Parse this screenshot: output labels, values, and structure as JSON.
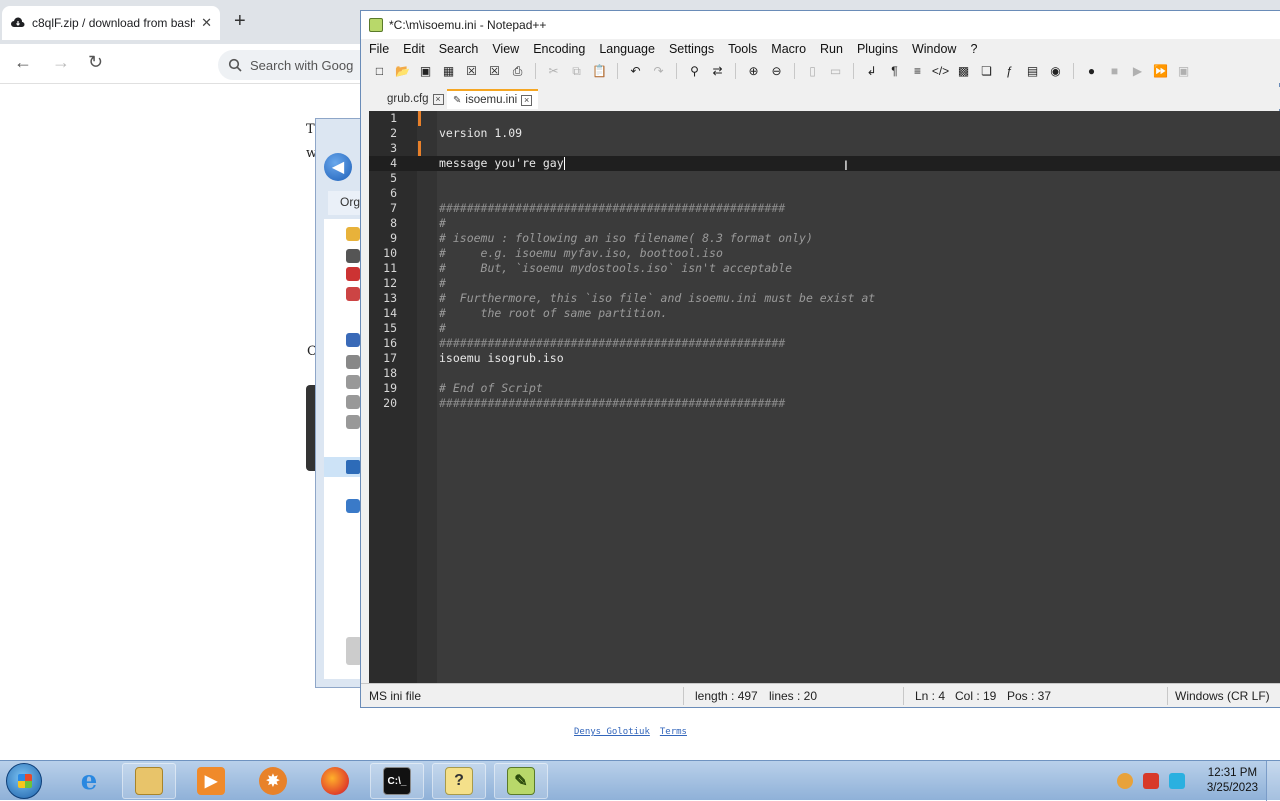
{
  "browser": {
    "tab_title": "c8qlF.zip / download from bash",
    "tab_close": "✕",
    "new_tab": "+",
    "search_placeholder": "Search with Goog",
    "page_fragment_1": "T",
    "page_fragment_2": "w",
    "page_fragment_3": "C",
    "footer_links": [
      "Denys Golotiuk",
      "Terms"
    ]
  },
  "explorer": {
    "organize_label": "Org"
  },
  "npp": {
    "title": "*C:\\m\\isoemu.ini - Notepad++",
    "menu": [
      "File",
      "Edit",
      "Search",
      "View",
      "Encoding",
      "Language",
      "Settings",
      "Tools",
      "Macro",
      "Run",
      "Plugins",
      "Window",
      "?"
    ],
    "tabs": [
      {
        "label": "grub.cfg",
        "active": false
      },
      {
        "label": "isoemu.ini",
        "active": true
      }
    ],
    "lines": [
      {
        "n": "1",
        "text": "",
        "kind": "code"
      },
      {
        "n": "2",
        "text": "version 1.09",
        "kind": "code"
      },
      {
        "n": "3",
        "text": "",
        "kind": "code"
      },
      {
        "n": "4",
        "text": "message you're gay",
        "kind": "code"
      },
      {
        "n": "5",
        "text": "",
        "kind": "code"
      },
      {
        "n": "6",
        "text": "",
        "kind": "code"
      },
      {
        "n": "7",
        "text": "##################################################",
        "kind": "hash"
      },
      {
        "n": "8",
        "text": "#",
        "kind": "comment"
      },
      {
        "n": "9",
        "text": "# isoemu : following an iso filename( 8.3 format only)",
        "kind": "comment"
      },
      {
        "n": "10",
        "text": "#     e.g. isoemu myfav.iso, boottool.iso",
        "kind": "comment"
      },
      {
        "n": "11",
        "text": "#     But, `isoemu mydostools.iso` isn't acceptable",
        "kind": "comment"
      },
      {
        "n": "12",
        "text": "#",
        "kind": "comment"
      },
      {
        "n": "13",
        "text": "#  Furthermore, this `iso file` and isoemu.ini must be exist at",
        "kind": "comment"
      },
      {
        "n": "14",
        "text": "#     the root of same partition.",
        "kind": "comment"
      },
      {
        "n": "15",
        "text": "#",
        "kind": "comment"
      },
      {
        "n": "16",
        "text": "##################################################",
        "kind": "hash"
      },
      {
        "n": "17",
        "text": "isoemu isogrub.iso",
        "kind": "code"
      },
      {
        "n": "18",
        "text": "",
        "kind": "code"
      },
      {
        "n": "19",
        "text": "# End of Script",
        "kind": "comment"
      },
      {
        "n": "20",
        "text": "##################################################",
        "kind": "hash"
      }
    ],
    "status": {
      "lang": "MS ini file",
      "length": "length : 497",
      "lines": "lines : 20",
      "ln": "Ln : 4",
      "col": "Col : 19",
      "pos": "Pos : 37",
      "eol": "Windows (CR LF)"
    }
  },
  "taskbar": {
    "time": "12:31 PM",
    "date": "3/25/2023"
  }
}
